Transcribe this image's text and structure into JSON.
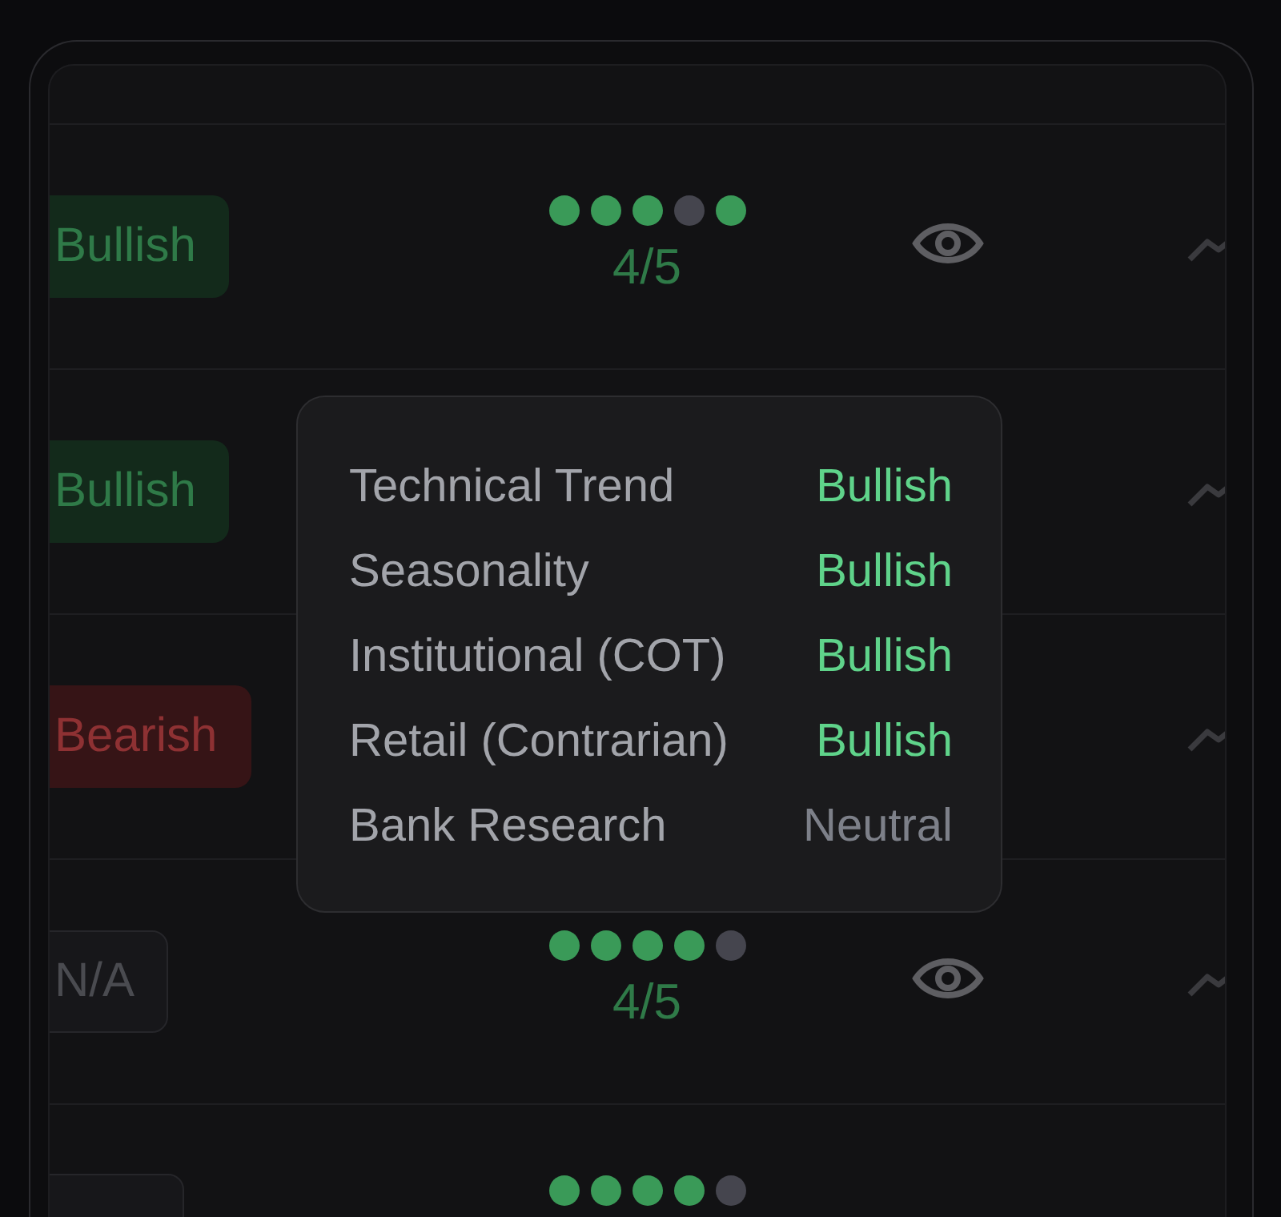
{
  "rows": [
    {
      "badge": {
        "label": "Bullish",
        "kind": "bullish"
      },
      "dots": [
        {
          "on": true
        },
        {
          "on": true
        },
        {
          "on": true
        },
        {
          "on": false
        },
        {
          "on": true
        }
      ],
      "score": "4/5"
    },
    {
      "badge": {
        "label": "Bullish",
        "kind": "bullish"
      }
    },
    {
      "badge": {
        "label": "Bearish",
        "kind": "bearish"
      }
    },
    {
      "badge": {
        "label": "N/A",
        "kind": "neutral"
      },
      "dots": [
        {
          "on": true
        },
        {
          "on": true
        },
        {
          "on": true
        },
        {
          "on": true
        },
        {
          "on": false
        }
      ],
      "score": "4/5"
    },
    {
      "badge": {
        "kind": "neutral"
      },
      "dots": [
        {
          "on": true
        },
        {
          "on": true
        },
        {
          "on": true
        },
        {
          "on": true
        },
        {
          "on": false
        }
      ]
    }
  ],
  "tooltip": {
    "rows": [
      {
        "label": "Technical Trend",
        "value": "Bullish",
        "kind": "bullish"
      },
      {
        "label": "Seasonality",
        "value": "Bullish",
        "kind": "bullish"
      },
      {
        "label": "Institutional (COT)",
        "value": "Bullish",
        "kind": "bullish"
      },
      {
        "label": "Retail (Contrarian)",
        "value": "Bullish",
        "kind": "bullish"
      },
      {
        "label": "Bank Research",
        "value": "Neutral",
        "kind": "neutral"
      }
    ]
  }
}
